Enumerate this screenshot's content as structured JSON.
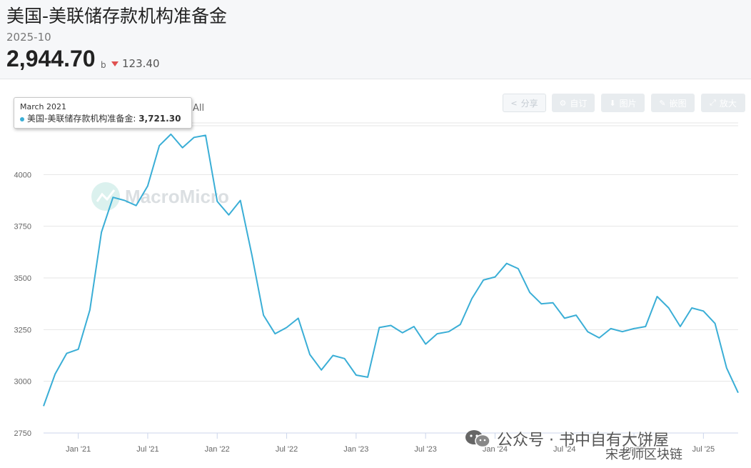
{
  "header": {
    "title": "美国-美联储存款机构准备金",
    "period": "2025-10",
    "latest_value": "2,944.70",
    "unit": "b",
    "change": "123.40",
    "change_color": "#e05050"
  },
  "range_selector": {
    "all_label": "All"
  },
  "toolbar": {
    "share": {
      "label": "分享",
      "icon": "share-icon"
    },
    "settings": {
      "label": "自订",
      "icon": "gear-icon"
    },
    "image": {
      "label": "图片",
      "icon": "download-icon"
    },
    "embed": {
      "label": "嵌图",
      "icon": "pencil-icon"
    },
    "expand": {
      "label": "放大",
      "icon": "expand-icon"
    }
  },
  "tooltip": {
    "date": "March 2021",
    "series": "美国-美联储存款机构准备金:",
    "value": "3,721.30"
  },
  "watermark": {
    "text": "MacroMicro"
  },
  "overlay": {
    "wechat": "公众号 · 书中自有大饼屋",
    "author": "宋老师区块链"
  },
  "chart_data": {
    "type": "line",
    "series_color": "#3aaed6",
    "title": "美国-美联储存款机构准备金",
    "x_unit": "month",
    "x": [
      "2020-10",
      "2020-11",
      "2020-12",
      "2021-01",
      "2021-02",
      "2021-03",
      "2021-04",
      "2021-05",
      "2021-06",
      "2021-07",
      "2021-08",
      "2021-09",
      "2021-10",
      "2021-11",
      "2021-12",
      "2022-01",
      "2022-02",
      "2022-03",
      "2022-04",
      "2022-05",
      "2022-06",
      "2022-07",
      "2022-08",
      "2022-09",
      "2022-10",
      "2022-11",
      "2022-12",
      "2023-01",
      "2023-02",
      "2023-03",
      "2023-04",
      "2023-05",
      "2023-06",
      "2023-07",
      "2023-08",
      "2023-09",
      "2023-10",
      "2023-11",
      "2023-12",
      "2024-01",
      "2024-02",
      "2024-03",
      "2024-04",
      "2024-05",
      "2024-06",
      "2024-07",
      "2024-08",
      "2024-09",
      "2024-10",
      "2024-11",
      "2024-12",
      "2025-01",
      "2025-02",
      "2025-03",
      "2025-04",
      "2025-05",
      "2025-06",
      "2025-07",
      "2025-08",
      "2025-09",
      "2025-10"
    ],
    "values": [
      2880,
      3035,
      3135,
      3155,
      3345,
      3721.3,
      3890,
      3875,
      3850,
      3945,
      4140,
      4195,
      4130,
      4180,
      4190,
      3870,
      3805,
      3875,
      3610,
      3320,
      3230,
      3260,
      3305,
      3130,
      3055,
      3125,
      3110,
      3030,
      3020,
      3260,
      3270,
      3235,
      3265,
      3180,
      3230,
      3240,
      3275,
      3400,
      3490,
      3505,
      3570,
      3545,
      3430,
      3375,
      3380,
      3305,
      3320,
      3240,
      3210,
      3255,
      3240,
      3255,
      3265,
      3410,
      3355,
      3265,
      3355,
      3340,
      3280,
      3065,
      2944.7
    ],
    "x_ticks": [
      "Jan '21",
      "Jul '21",
      "Jan '22",
      "Jul '22",
      "Jan '23",
      "Jul '23",
      "Jan '24",
      "Jul '24",
      "Jan '25",
      "Jul '25"
    ],
    "y_ticks": [
      2750,
      3000,
      3250,
      3500,
      3750,
      4000,
      4250
    ],
    "ylim": [
      2750,
      4250
    ],
    "grid": true,
    "legend": "none"
  }
}
